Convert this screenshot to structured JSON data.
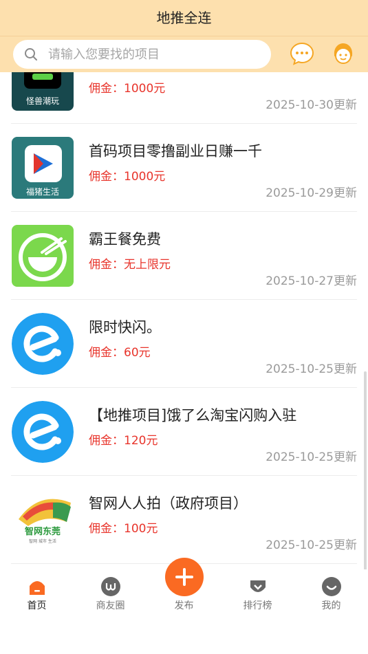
{
  "header": {
    "title": "地推全连",
    "search_placeholder": "请输入您要找的项目",
    "message_icon": "chat-bubble-icon",
    "service_icon": "customer-service-icon",
    "bg_color": "#fde0ae"
  },
  "items": [
    {
      "thumb_label": "怪兽潮玩",
      "commission": "佣金：1000元",
      "date": "2025-10-30更新"
    },
    {
      "title": "首码项目零撸副业日赚一千",
      "thumb_label": "福猪生活",
      "commission": "佣金：1000元",
      "date": "2025-10-29更新"
    },
    {
      "title": "霸王餐免费",
      "commission": "佣金：无上限元",
      "date": "2025-10-27更新"
    },
    {
      "title": "限时快闪。",
      "commission": "佣金：60元",
      "date": "2025-10-25更新"
    },
    {
      "title": "【地推项目]饿了么淘宝闪购入驻",
      "commission": "佣金：120元",
      "date": "2025-10-25更新"
    },
    {
      "title": "智网人人拍（政府项目）",
      "thumb_label": "智网东莞",
      "thumb_sublabel": "智网 城市 生活",
      "commission": "佣金：100元",
      "date": "2025-10-25更新"
    }
  ],
  "tabbar": {
    "home": "首页",
    "friends": "商友圈",
    "publish": "发布",
    "ranking": "排行榜",
    "mine": "我的"
  },
  "colors": {
    "accent": "#fa6a22",
    "price": "#e8342b",
    "eleme_blue": "#1fa0f0"
  }
}
